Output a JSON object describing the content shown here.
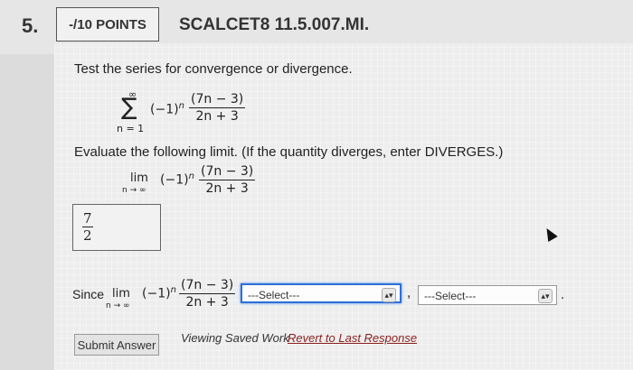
{
  "header": {
    "question_number": "5.",
    "points_label": "-/10 POINTS",
    "problem_code": "SCALCET8 11.5.007.MI."
  },
  "prompt": {
    "instruction": "Test the series for convergence or divergence.",
    "sigma": "∑",
    "upper_limit": "∞",
    "lower_limit": "n = 1",
    "term_base": "(−1)",
    "term_exp": "n",
    "numerator": "(7n − 3)",
    "denominator": "2n + 3"
  },
  "limit_prompt": {
    "instruction": "Evaluate the following limit. (If the quantity diverges, enter DIVERGES.)",
    "lim": "lim",
    "lim_sub": "n → ∞",
    "term_base": "(−1)",
    "term_exp": "n",
    "numerator": "(7n − 3)",
    "denominator": "2n + 3"
  },
  "answer": {
    "numerator": "7",
    "denominator": "2"
  },
  "since_row": {
    "since_label": "Since",
    "lim": "lim",
    "lim_sub": "n → ∞",
    "term_base": "(−1)",
    "term_exp": "n",
    "numerator": "(7n − 3)",
    "denominator": "2n + 3",
    "select1_value": "---Select---",
    "comma": ",",
    "select2_value": "---Select---",
    "period": "."
  },
  "footer": {
    "submit_label": "Submit Answer",
    "viewing_label": "Viewing Saved Work",
    "revert_label": "Revert to Last Response"
  }
}
